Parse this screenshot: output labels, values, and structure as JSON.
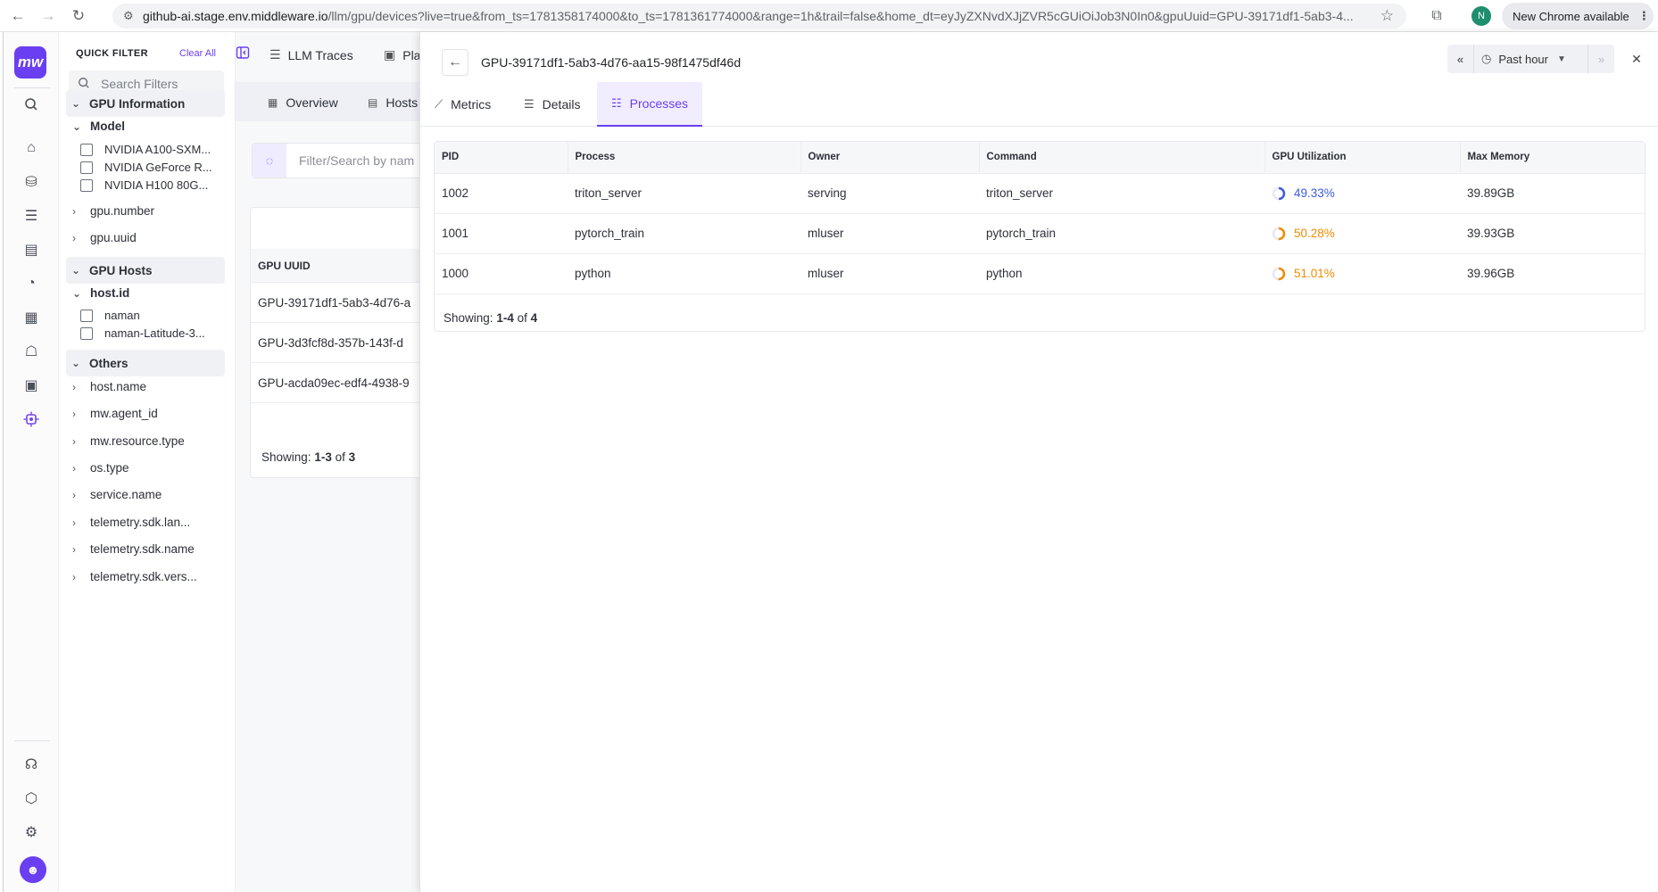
{
  "browser": {
    "url_host": "github-ai.stage.env.middleware.io",
    "url_path": "/llm/gpu/devices?live=true&from_ts=1781358174000&to_ts=1781361774000&range=1h&trail=false&home_dt=eyJyZXNvdXJjZVR5cGUiOiJob3N0In0&gpuUuid=GPU-39171df1-5ab3-4...",
    "profile_initial": "N",
    "update_label": "New Chrome available"
  },
  "app": {
    "logo_text": "mw",
    "avatar_glyph": "☻",
    "accent_color": "#6a3ff2"
  },
  "quick_filter": {
    "title": "QUICK FILTER",
    "clear_label": "Clear All",
    "search_placeholder": "Search Filters",
    "sections": [
      {
        "label": "GPU Information",
        "groups": [
          {
            "label": "Model",
            "options": [
              "NVIDIA A100-SXM...",
              "NVIDIA GeForce R...",
              "NVIDIA H100 80G..."
            ]
          }
        ],
        "collapsed": [
          "gpu.number",
          "gpu.uuid"
        ]
      },
      {
        "label": "GPU Hosts",
        "groups": [
          {
            "label": "host.id",
            "options": [
              "naman",
              "naman-Latitude-3..."
            ]
          }
        ]
      },
      {
        "label": "Others",
        "collapsed": [
          "host.name",
          "mw.agent_id",
          "mw.resource.type",
          "os.type",
          "service.name",
          "telemetry.sdk.lan...",
          "telemetry.sdk.name",
          "telemetry.sdk.vers..."
        ]
      }
    ]
  },
  "main": {
    "top_tabs": [
      "LLM Traces",
      "Pla"
    ],
    "sub_tabs": [
      "Overview",
      "Hosts"
    ],
    "search_placeholder": "Filter/Search by nam",
    "column_header": "GPU UUID",
    "rows": [
      "GPU-39171df1-5ab3-4d76-a",
      "GPU-3d3fcf8d-357b-143f-d",
      "GPU-acda09ec-edf4-4938-9"
    ],
    "showing_prefix": "Showing:",
    "showing_range": "1-3",
    "showing_of": "of",
    "showing_total": "3"
  },
  "drawer": {
    "title": "GPU-39171df1-5ab3-4d76-aa15-98f1475df46d",
    "time_range": "Past hour",
    "tabs": [
      "Metrics",
      "Details",
      "Processes"
    ],
    "active_tab": "Processes",
    "columns": [
      "PID",
      "Process",
      "Owner",
      "Command",
      "GPU Utilization",
      "Max Memory"
    ],
    "rows": [
      {
        "pid": "1002",
        "process": "triton_server",
        "owner": "serving",
        "command": "triton_server",
        "gpu_util": "49.33%",
        "gpu_util_fraction": 0.4933,
        "util_color": "#3b5bdb",
        "max_memory": "39.89GB"
      },
      {
        "pid": "1001",
        "process": "pytorch_train",
        "owner": "mluser",
        "command": "pytorch_train",
        "gpu_util": "50.28%",
        "gpu_util_fraction": 0.5028,
        "util_color": "#f08c00",
        "max_memory": "39.93GB"
      },
      {
        "pid": "1000",
        "process": "python",
        "owner": "mluser",
        "command": "python",
        "gpu_util": "51.01%",
        "gpu_util_fraction": 0.5101,
        "util_color": "#f08c00",
        "max_memory": "39.96GB"
      }
    ],
    "showing_prefix": "Showing:",
    "showing_range": "1-4",
    "showing_of": "of",
    "showing_total": "4"
  }
}
